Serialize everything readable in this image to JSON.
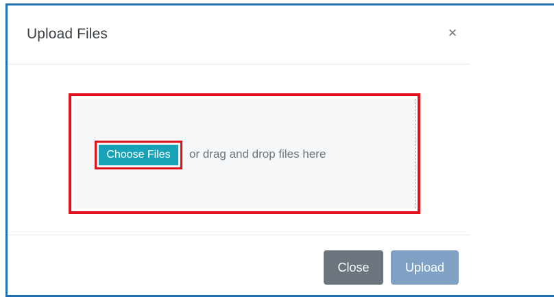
{
  "modal": {
    "title": "Upload Files",
    "close_icon": "×"
  },
  "dropzone": {
    "choose_label": "Choose Files",
    "hint": "or drag and drop files here"
  },
  "footer": {
    "close_label": "Close",
    "upload_label": "Upload"
  },
  "colors": {
    "choose_button": "#17a2b8",
    "close_button": "#6c757d",
    "upload_button_disabled": "#7fa1c4",
    "highlight_outline": "#e0101c",
    "window_frame": "#1f6fb2"
  },
  "icons": {
    "close": "close-icon"
  }
}
